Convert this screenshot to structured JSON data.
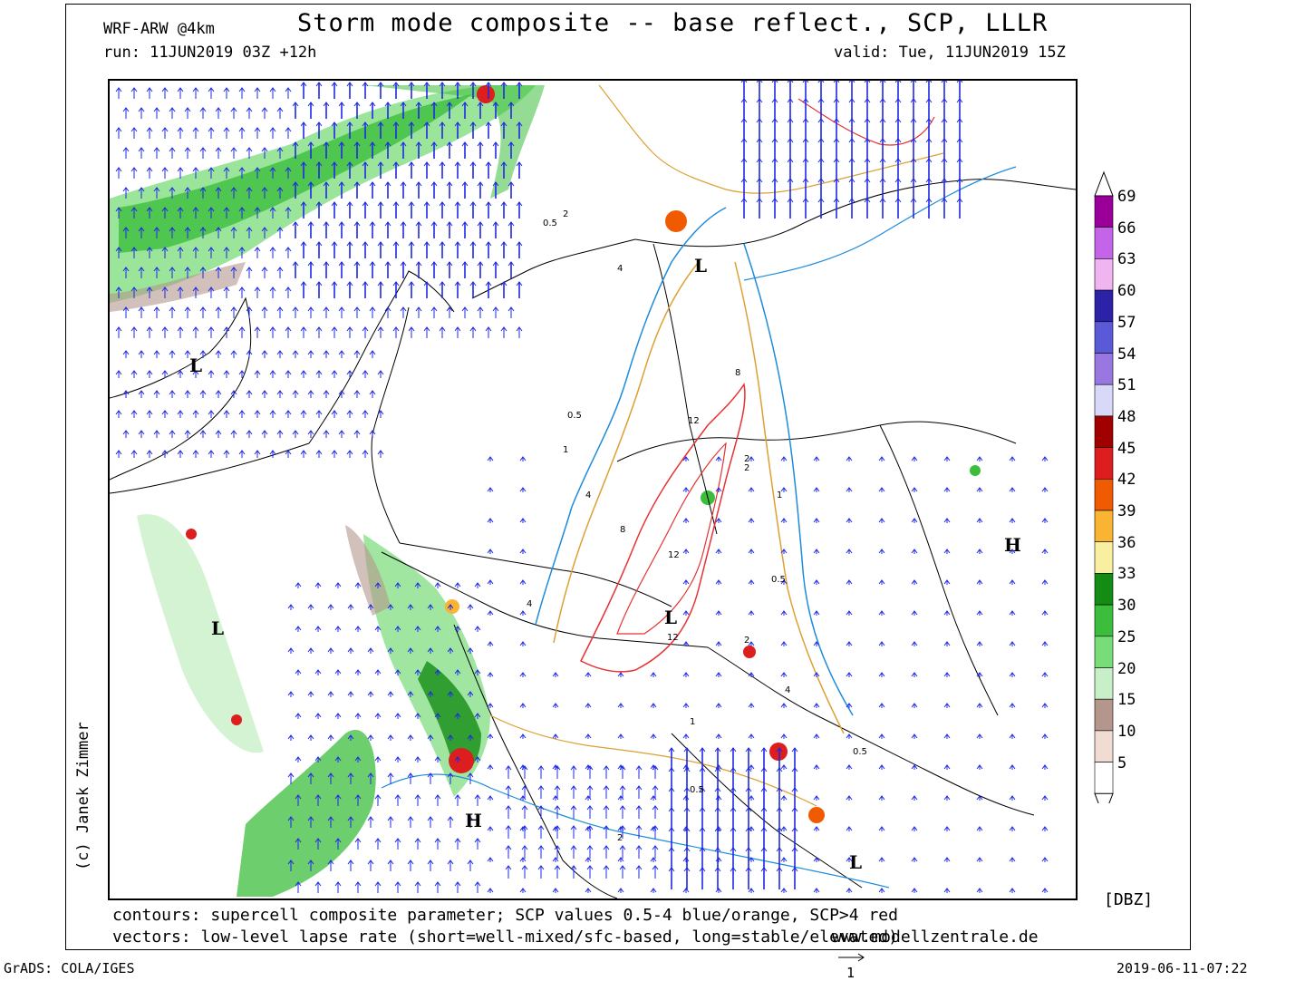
{
  "header": {
    "title": "Storm mode composite -- base reflect., SCP, LLLR",
    "model": "WRF-ARW @4km",
    "run": "run: 11JUN2019 03Z +12h",
    "valid": "valid: Tue, 11JUN2019 15Z"
  },
  "footer": {
    "contours_note": "contours: supercell composite parameter; SCP values 0.5-4 blue/orange, SCP>4 red",
    "vectors_note": "vectors: low-level lapse rate (short=well-mixed/sfc-based, long=stable/elevated)",
    "site": "www.modellzentrale.de",
    "grads": "GrADS: COLA/IGES",
    "timestamp": "2019-06-11-07:22",
    "vector_scale": "1"
  },
  "credit": "(c) Janek Zimmer",
  "colorbar": {
    "unit": "[DBZ]",
    "levels": [
      {
        "value": "69",
        "color": "#9a0099"
      },
      {
        "value": "66",
        "color": "#c464e8"
      },
      {
        "value": "63",
        "color": "#f0b4f0"
      },
      {
        "value": "60",
        "color": "#2c22a8"
      },
      {
        "value": "57",
        "color": "#5a5ad8"
      },
      {
        "value": "54",
        "color": "#9878e0"
      },
      {
        "value": "51",
        "color": "#d8d8f8"
      },
      {
        "value": "48",
        "color": "#a00000"
      },
      {
        "value": "45",
        "color": "#dc1e1e"
      },
      {
        "value": "42",
        "color": "#f05a00"
      },
      {
        "value": "39",
        "color": "#f8b432"
      },
      {
        "value": "36",
        "color": "#f8f0a0"
      },
      {
        "value": "33",
        "color": "#148c14"
      },
      {
        "value": "30",
        "color": "#3cbe3c"
      },
      {
        "value": "25",
        "color": "#78dc78"
      },
      {
        "value": "20",
        "color": "#c8f0c8"
      },
      {
        "value": "15",
        "color": "#b4968c"
      },
      {
        "value": "10",
        "color": "#f0dcd2"
      },
      {
        "value": "5",
        "color": "#ffffff"
      }
    ]
  },
  "map_labels": {
    "pressure_centers": [
      "L",
      "L",
      "H",
      "L",
      "L",
      "H",
      "L"
    ],
    "scp_values": [
      "0.5",
      "2",
      "4",
      "8",
      "12",
      "2",
      "1",
      "0.5",
      "4",
      "12",
      "8",
      "12",
      "2",
      "4",
      "2",
      "1",
      "0.5",
      "4",
      "0.5",
      "1",
      "2",
      "0.5"
    ]
  }
}
